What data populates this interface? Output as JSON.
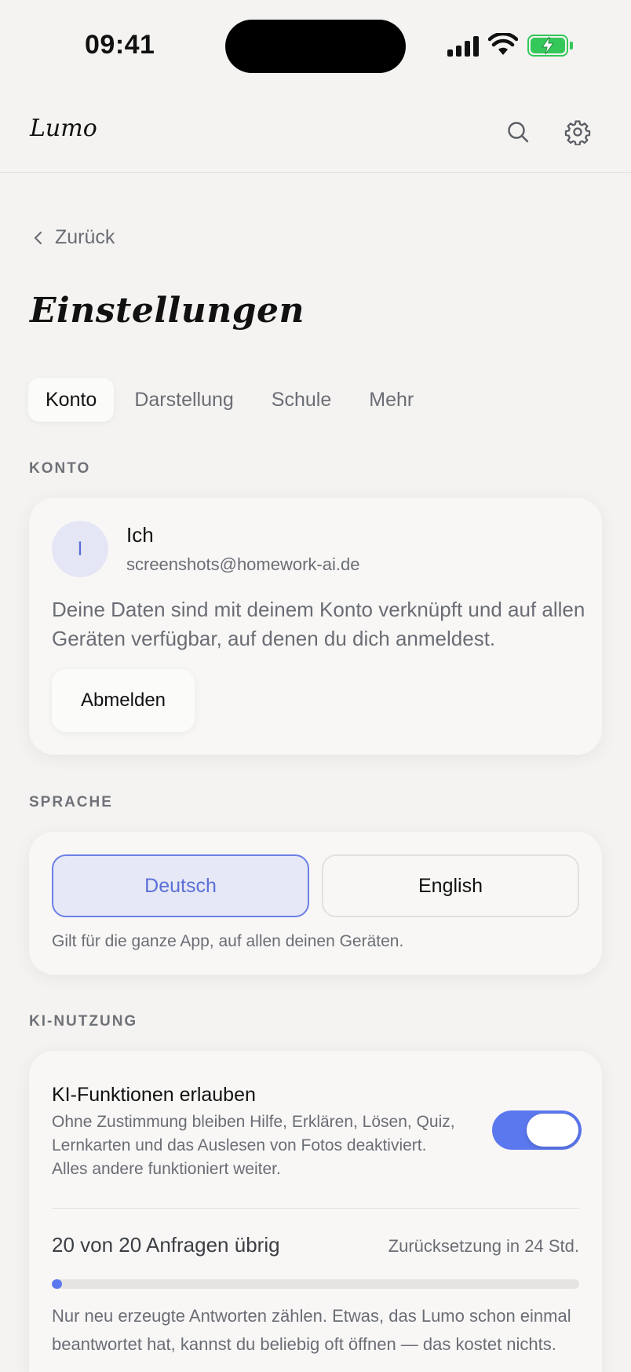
{
  "status_bar": {
    "time": "09:41"
  },
  "header": {
    "logo": "Lumo"
  },
  "nav": {
    "back_label": "Zurück"
  },
  "page": {
    "title": "Einstellungen"
  },
  "tabs": [
    {
      "label": "Konto",
      "active": true
    },
    {
      "label": "Darstellung",
      "active": false
    },
    {
      "label": "Schule",
      "active": false
    },
    {
      "label": "Mehr",
      "active": false
    }
  ],
  "account": {
    "section_label": "KONTO",
    "avatar_initial": "I",
    "name": "Ich",
    "email": "screenshots@homework-ai.de",
    "description": "Deine Daten sind mit deinem Konto verknüpft und auf allen Geräten verfügbar, auf denen du dich anmeldest.",
    "logout_label": "Abmelden"
  },
  "language": {
    "section_label": "SPRACHE",
    "options": [
      {
        "label": "Deutsch",
        "selected": true
      },
      {
        "label": "English",
        "selected": false
      }
    ],
    "hint": "Gilt für die ganze App, auf allen deinen Geräten."
  },
  "ai": {
    "section_label": "KI-NUTZUNG",
    "toggle_title": "KI-Funktionen erlauben",
    "toggle_description": "Ohne Zustimmung bleiben Hilfe, Erklären, Lösen, Quiz, Lernkarten und das Auslesen von Fotos deaktiviert. Alles andere funktioniert weiter.",
    "toggle_on": true,
    "quota_text": "20 von 20 Anfragen übrig",
    "reset_text": "Zurücksetzung in 24 Std.",
    "progress_fraction": 0.02,
    "note": "Nur neu erzeugte Antworten zählen. Etwas, das Lumo schon einmal beantwortet hat, kannst du beliebig oft öffnen — das kostet nichts."
  },
  "colors": {
    "accent": "#5c78ee",
    "battery": "#34c759",
    "background": "#f4f3f1"
  }
}
